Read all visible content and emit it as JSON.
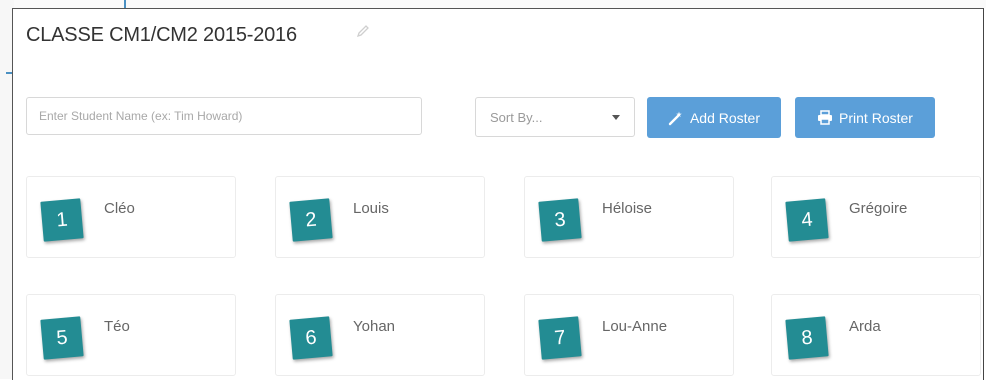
{
  "page": {
    "roster_title": "CLASSE CM1/CM2 2015-2016"
  },
  "toolbar": {
    "search_placeholder": "Enter Student Name (ex: Tim Howard)",
    "sort_label": "Sort By...",
    "add_roster_label": "Add Roster",
    "print_roster_label": "Print Roster",
    "edit_icon": "pencil-icon",
    "add_icon": "magic-wand-icon",
    "print_icon": "printer-icon"
  },
  "colors": {
    "button_blue": "#5b9fd9",
    "badge_teal": "#238c93"
  },
  "students": [
    {
      "number": "1",
      "name": "Cléo"
    },
    {
      "number": "2",
      "name": "Louis"
    },
    {
      "number": "3",
      "name": "Héloise"
    },
    {
      "number": "4",
      "name": "Grégoire"
    },
    {
      "number": "5",
      "name": "Téo"
    },
    {
      "number": "6",
      "name": "Yohan"
    },
    {
      "number": "7",
      "name": "Lou-Anne"
    },
    {
      "number": "8",
      "name": "Arda"
    }
  ]
}
